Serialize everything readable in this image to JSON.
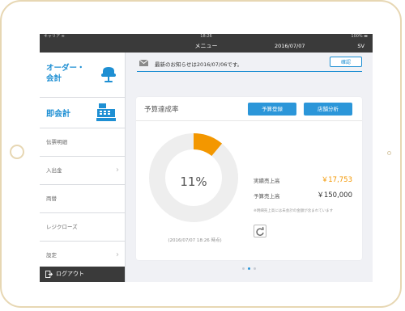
{
  "status_bar": {
    "carrier": "キャリア  ≋",
    "time": "18:26",
    "battery": "100% ▬"
  },
  "nav": {
    "title": "メニュー",
    "date": "2016/07/07",
    "user": "SV"
  },
  "sidebar": {
    "order_label_line1": "オーダー・",
    "order_label_line2": "会計",
    "quick_label": "即会計",
    "items": [
      {
        "label": "伝票明細"
      },
      {
        "label": "入出金",
        "chevron": "›"
      },
      {
        "label": "両替"
      },
      {
        "label": "レジクローズ"
      },
      {
        "label": "設定",
        "chevron": "›"
      }
    ],
    "logout_label": "ログアウト"
  },
  "notice": {
    "text": "最新のお知らせは2016/07/06です。",
    "confirm_label": "確認"
  },
  "budget": {
    "title": "予算達成率",
    "register_label": "予算登録",
    "analysis_label": "店舗分析",
    "percent": 11,
    "percent_label": "11%",
    "timestamp": "(2016/07/07 18:26 時点)",
    "actual_label": "実績売上高",
    "actual_value": "￥17,753",
    "budget_label": "予算売上高",
    "budget_value": "￥150,000",
    "footnote": "※明細売上高には未会計の金額が含まれています"
  },
  "colors": {
    "accent_blue": "#2b96d9",
    "progress_orange": "#f39700",
    "ring_gray": "#eeeeee",
    "dark_bar": "#3a3a3a"
  },
  "pager": {
    "page_count": 3,
    "active_page": 2
  }
}
